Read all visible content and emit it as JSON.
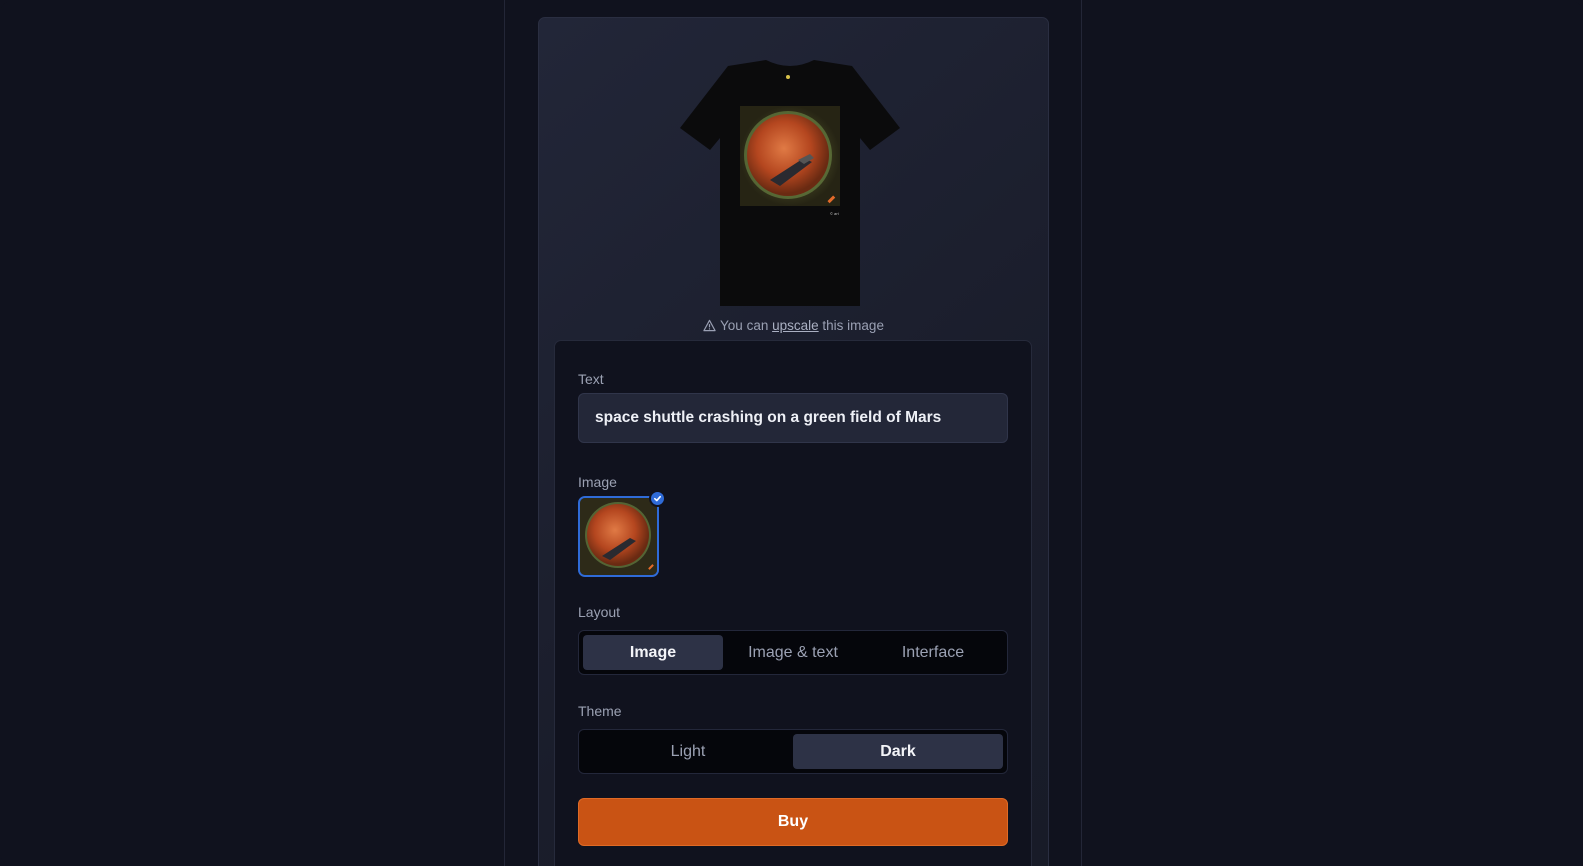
{
  "preview": {
    "mockup_icon": "tshirt-mockup",
    "artwork_icon": "mars-shuttle-artwork"
  },
  "hint": {
    "prefix": "You can",
    "link": "upscale",
    "suffix": "this image",
    "icon": "warning-triangle-icon"
  },
  "form": {
    "text_label": "Text",
    "text_value": "space shuttle crashing on a green field of Mars",
    "image_label": "Image",
    "image_selected": true,
    "layout_label": "Layout",
    "layout_options": [
      "Image",
      "Image & text",
      "Interface"
    ],
    "layout_selected": "Image",
    "theme_label": "Theme",
    "theme_options": [
      "Light",
      "Dark"
    ],
    "theme_selected": "Dark",
    "buy_label": "Buy"
  },
  "colors": {
    "background": "#10121e",
    "accent": "#c95314",
    "selection": "#2f6bd8"
  }
}
